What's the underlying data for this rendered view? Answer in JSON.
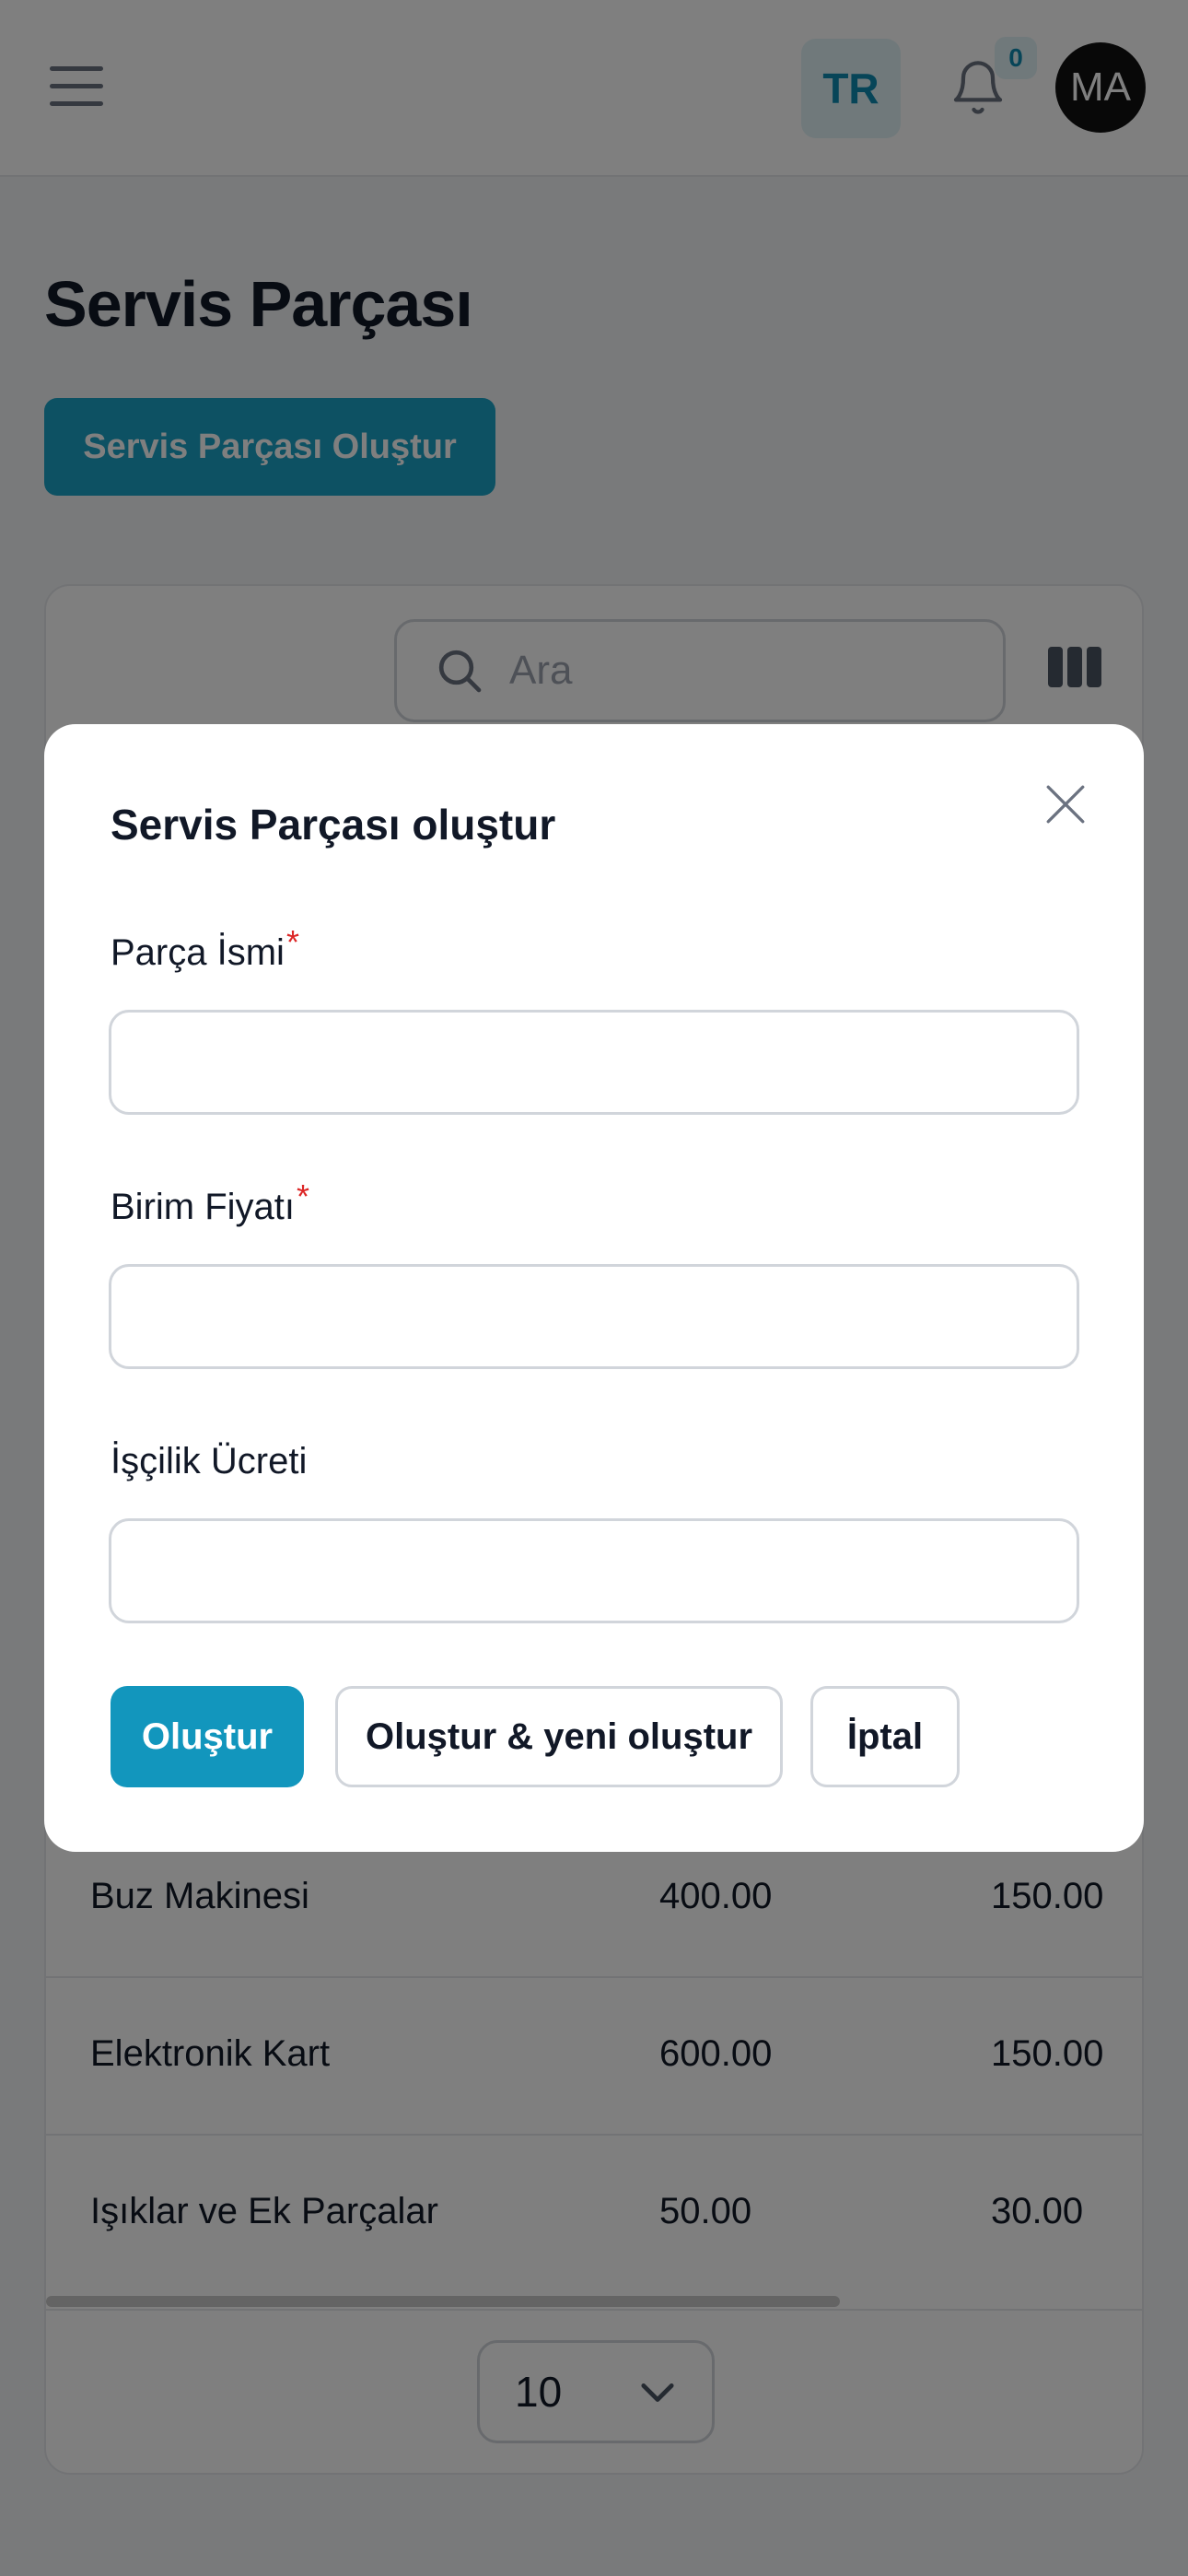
{
  "header": {
    "language": "TR",
    "notification_count": "0",
    "avatar_initials": "MA",
    "icons": [
      "menu-icon",
      "bell-icon"
    ]
  },
  "page": {
    "title": "Servis Parçası",
    "create_button": "Servis Parçası Oluştur"
  },
  "table": {
    "search_placeholder": "Ara",
    "rows": [
      {
        "name": "Buz Makinesi",
        "unit_price": "400.00",
        "labor_fee": "150.00"
      },
      {
        "name": "Elektronik Kart",
        "unit_price": "600.00",
        "labor_fee": "150.00"
      },
      {
        "name": "Işıklar ve Ek Parçalar",
        "unit_price": "50.00",
        "labor_fee": "30.00"
      }
    ],
    "per_page": "10"
  },
  "modal": {
    "title": "Servis Parçası oluştur",
    "fields": [
      {
        "label": "Parça İsmi",
        "required": "*",
        "value": ""
      },
      {
        "label": "Birim Fiyatı",
        "required": "*",
        "value": ""
      },
      {
        "label": "İşçilik Ücreti",
        "required": "",
        "value": ""
      }
    ],
    "buttons": {
      "create": "Oluştur",
      "create_and_new": "Oluştur & yeni oluştur",
      "cancel": "İptal"
    }
  },
  "colors": {
    "primary": "#1296bd",
    "required": "#dc2626",
    "overlay": "rgba(0,0,0,0.5)"
  }
}
